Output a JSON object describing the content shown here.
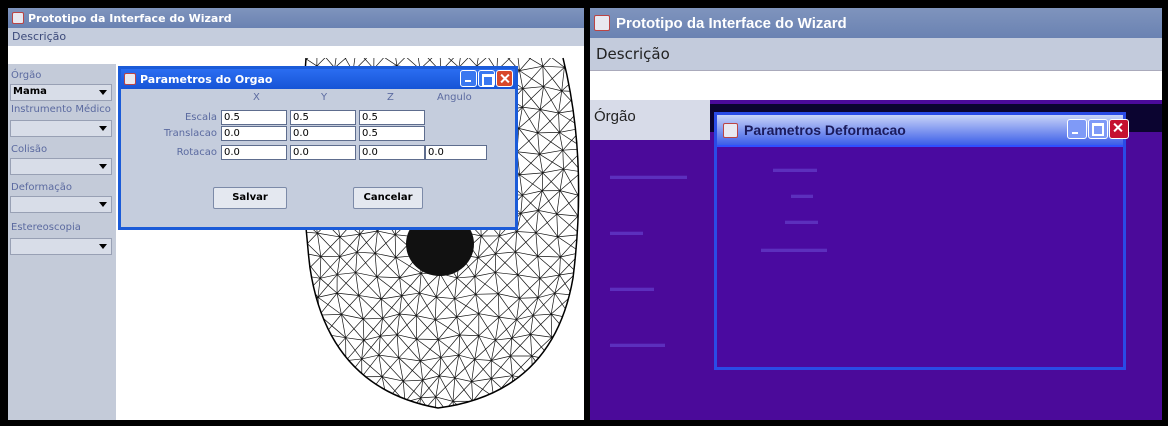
{
  "left": {
    "window_title": "Prototipo da Interface do Wizard",
    "menu_label": "Descrição",
    "sidebar": {
      "items": [
        {
          "label": "Órgão",
          "value": "Mama"
        },
        {
          "label": "Instrumento Médico",
          "value": ""
        },
        {
          "label": "Colisão",
          "value": ""
        },
        {
          "label": "Deformação",
          "value": ""
        },
        {
          "label": "Estereoscopia",
          "value": ""
        }
      ]
    },
    "dialog": {
      "title": "Parametros do Orgao",
      "columns": [
        "X",
        "Y",
        "Z",
        "Angulo"
      ],
      "rows": [
        {
          "label": "Escala",
          "values": [
            "0.5",
            "0.5",
            "0.5"
          ]
        },
        {
          "label": "Translacao",
          "values": [
            "0.0",
            "0.0",
            "0.5"
          ]
        },
        {
          "label": "Rotacao",
          "values": [
            "0.0",
            "0.0",
            "0.0",
            "0.0"
          ]
        }
      ],
      "save_label": "Salvar",
      "cancel_label": "Cancelar"
    }
  },
  "right": {
    "window_title": "Prototipo da Interface do Wizard",
    "menu_label": "Descrição",
    "sidebar_label": "Órgão",
    "dialog": {
      "title": "Parametros Deformacao"
    }
  },
  "colors": {
    "title_gradient": "#7f94bd",
    "dialog_title": "#1654d6",
    "right_background": "#4b0a9a"
  }
}
